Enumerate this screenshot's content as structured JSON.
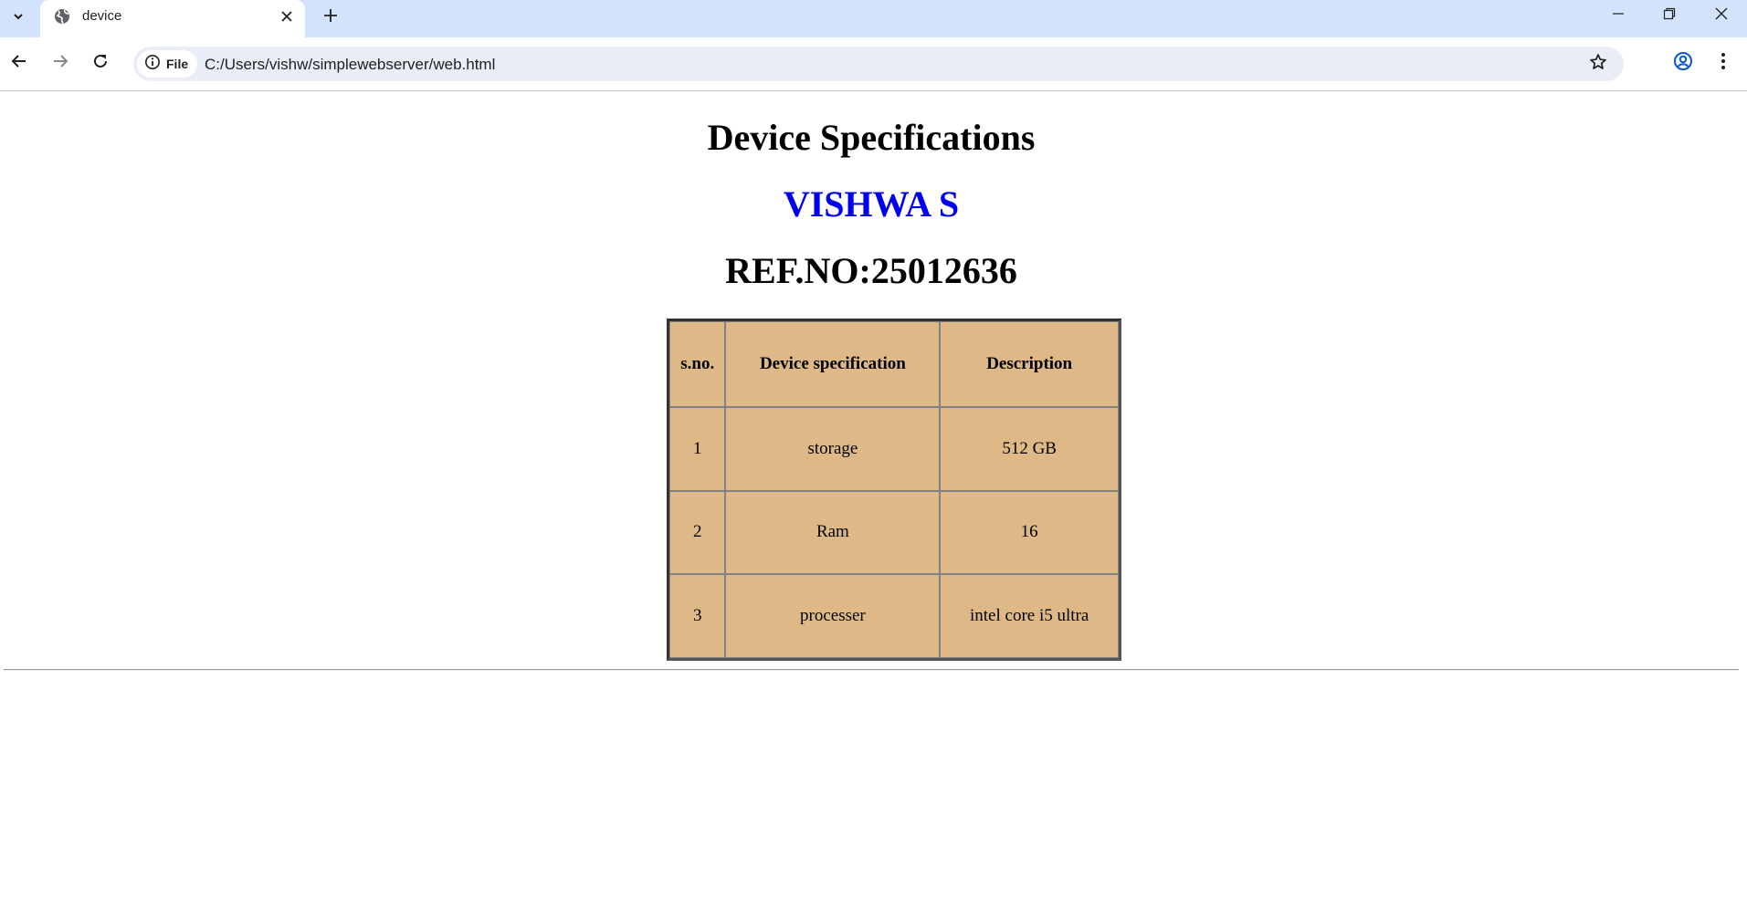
{
  "browser": {
    "tab": {
      "title": "device"
    },
    "address": {
      "chip_label": "File",
      "url": "C:/Users/vishw/simplewebserver/web.html"
    },
    "icons": {
      "tab_search": "chevron-down-icon",
      "favicon": "globe-icon",
      "tab_close": "close-icon",
      "new_tab": "plus-icon",
      "minimize": "minimize-icon",
      "restore": "restore-icon",
      "close_window": "close-icon",
      "back": "arrow-left-icon",
      "forward": "arrow-right-icon",
      "reload": "reload-icon",
      "site_info": "info-icon",
      "bookmark": "star-icon",
      "profile": "profile-icon",
      "menu": "kebab-menu-icon"
    },
    "colors": {
      "tabstrip": "#d3e3fd",
      "omnibox": "#e9eef6"
    }
  },
  "page": {
    "title": "Device Specifications",
    "name": "VISHWA S",
    "ref_no": "REF.NO:25012636",
    "colors": {
      "name": "#0000ee",
      "table_background": "#deb887"
    },
    "table": {
      "headers": [
        "s.no.",
        "Device specification",
        "Description"
      ],
      "rows": [
        [
          "1",
          "storage",
          "512 GB"
        ],
        [
          "2",
          "Ram",
          "16"
        ],
        [
          "3",
          "processer",
          "intel core i5 ultra"
        ]
      ]
    }
  }
}
